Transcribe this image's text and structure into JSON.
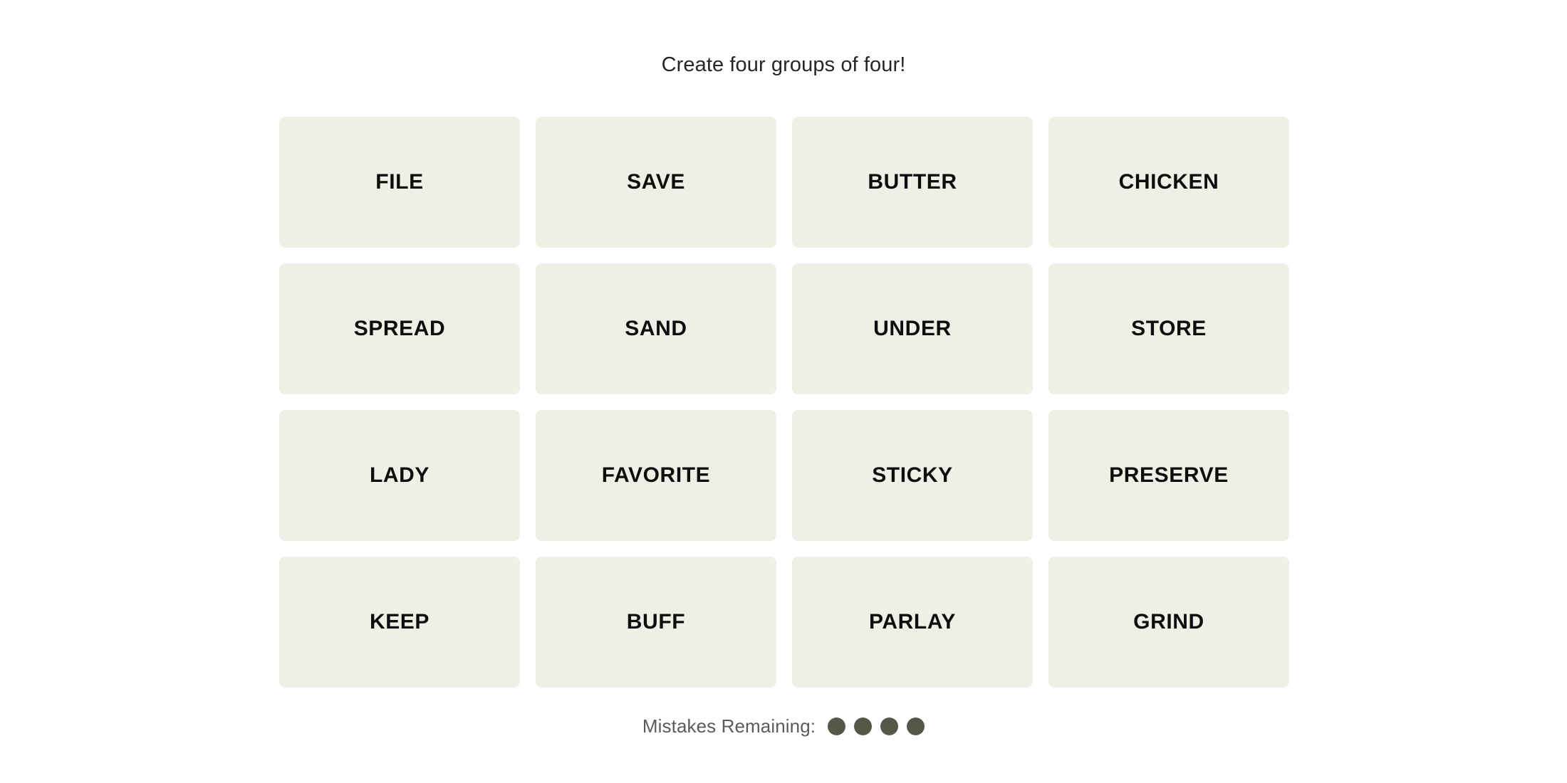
{
  "app": {
    "name": "connections-word-puzzle",
    "background_color": "#FFFFFF"
  },
  "header": {
    "title": "Create four groups of four!"
  },
  "board": {
    "rows": 4,
    "columns": 4,
    "tile_color": "#EFEFE6",
    "tile_text_color": "#0E0E0E",
    "tiles": [
      {
        "label": "FILE",
        "row": 1,
        "col": 1,
        "selected": false
      },
      {
        "label": "SAVE",
        "row": 1,
        "col": 2,
        "selected": false
      },
      {
        "label": "BUTTER",
        "row": 1,
        "col": 3,
        "selected": false
      },
      {
        "label": "CHICKEN",
        "row": 1,
        "col": 4,
        "selected": false
      },
      {
        "label": "SPREAD",
        "row": 2,
        "col": 1,
        "selected": false
      },
      {
        "label": "SAND",
        "row": 2,
        "col": 2,
        "selected": false
      },
      {
        "label": "UNDER",
        "row": 2,
        "col": 3,
        "selected": false
      },
      {
        "label": "STORE",
        "row": 2,
        "col": 4,
        "selected": false
      },
      {
        "label": "LADY",
        "row": 3,
        "col": 1,
        "selected": false
      },
      {
        "label": "FAVORITE",
        "row": 3,
        "col": 2,
        "selected": false
      },
      {
        "label": "STICKY",
        "row": 3,
        "col": 3,
        "selected": false
      },
      {
        "label": "PRESERVE",
        "row": 3,
        "col": 4,
        "selected": false
      },
      {
        "label": "KEEP",
        "row": 4,
        "col": 1,
        "selected": false
      },
      {
        "label": "BUFF",
        "row": 4,
        "col": 2,
        "selected": false
      },
      {
        "label": "PARLAY",
        "row": 4,
        "col": 3,
        "selected": false
      },
      {
        "label": "GRIND",
        "row": 4,
        "col": 4,
        "selected": false
      }
    ]
  },
  "footer": {
    "mistakes_label": "Mistakes Remaining:",
    "mistakes_remaining": 4,
    "dot_color": "#565649",
    "dots": [
      1,
      2,
      3,
      4
    ]
  }
}
